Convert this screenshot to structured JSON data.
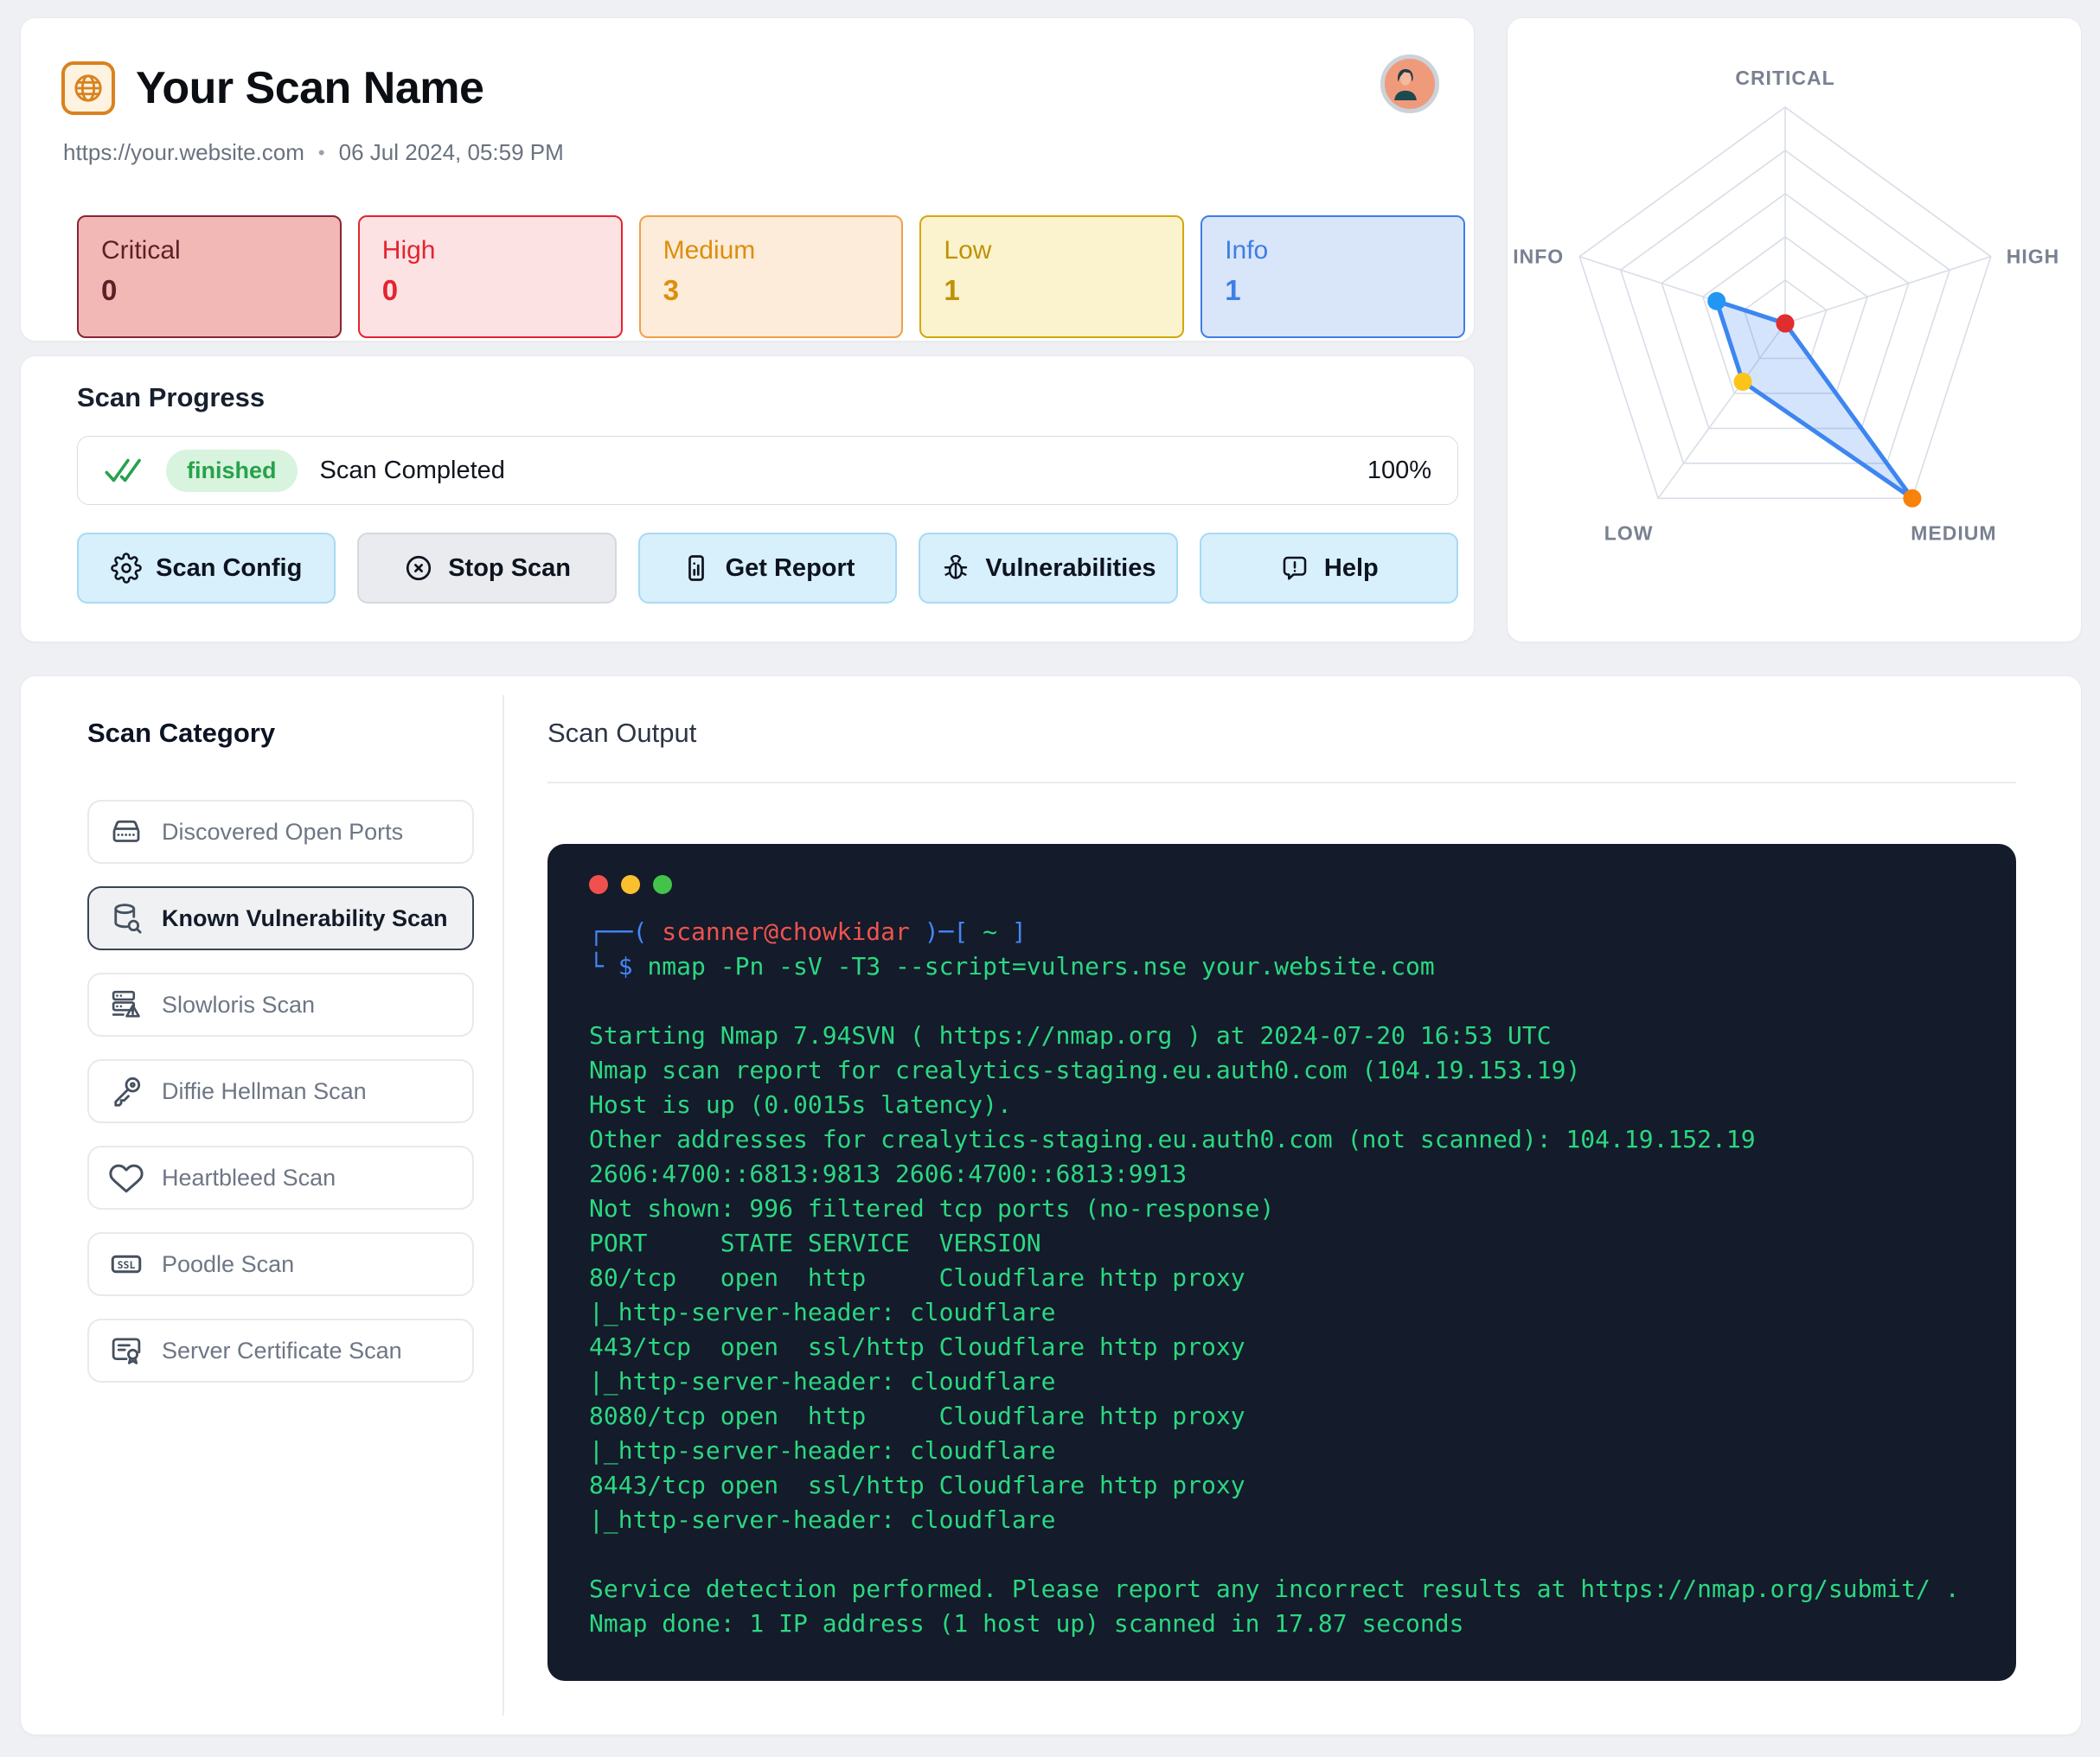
{
  "header": {
    "title": "Your Scan Name",
    "url": "https://your.website.com",
    "separator": "•",
    "timestamp": "06 Jul 2024, 05:59 PM",
    "severities": [
      {
        "label": "Critical",
        "count": "0",
        "bg": "#f2b8b5",
        "border": "#8a2433",
        "text": "#5e1f26"
      },
      {
        "label": "High",
        "count": "0",
        "bg": "#fde2e4",
        "border": "#e3242e",
        "text": "#e3242e"
      },
      {
        "label": "Medium",
        "count": "3",
        "bg": "#fcecd9",
        "border": "#f0a04a",
        "text": "#dd8e0b"
      },
      {
        "label": "Low",
        "count": "1",
        "bg": "#fbf3cd",
        "border": "#d2a80b",
        "text": "#bd920a"
      },
      {
        "label": "Info",
        "count": "1",
        "bg": "#d9e6f9",
        "border": "#3e7ee6",
        "text": "#3e7ee6"
      }
    ]
  },
  "progress": {
    "heading": "Scan Progress",
    "status_badge": "finished",
    "status_text": "Scan Completed",
    "percent": "100%",
    "badge_bg": "#d8f3de",
    "badge_text_color": "#27a24b",
    "buttons": [
      {
        "label": "Scan Config",
        "icon": "gear-icon",
        "variant": "blue"
      },
      {
        "label": "Stop Scan",
        "icon": "stop-icon",
        "variant": "gray"
      },
      {
        "label": "Get Report",
        "icon": "report-icon",
        "variant": "blue"
      },
      {
        "label": "Vulnerabilities",
        "icon": "bug-icon",
        "variant": "blue"
      },
      {
        "label": "Help",
        "icon": "help-icon",
        "variant": "blue"
      }
    ]
  },
  "chart_data": {
    "type": "radar",
    "title": "",
    "categories": [
      "CRITICAL",
      "HIGH",
      "MEDIUM",
      "LOW",
      "INFO"
    ],
    "values": [
      0,
      0,
      3,
      1,
      1
    ],
    "max": 3,
    "rings": 5,
    "fill": "rgba(66,133,244,0.22)",
    "stroke": "#3d86f0",
    "grid_color": "#d8dde7",
    "label_color": "#798191",
    "point_colors": [
      "#e12d2d",
      "#e12d2d",
      "#f9820a",
      "#fcc419",
      "#2196f3"
    ]
  },
  "categories_panel": {
    "heading": "Scan Category",
    "items": [
      {
        "label": "Discovered Open Ports",
        "icon": "ports-icon",
        "selected": false
      },
      {
        "label": "Known Vulnerability Scan",
        "icon": "database-search-icon",
        "selected": true
      },
      {
        "label": "Slowloris Scan",
        "icon": "server-warning-icon",
        "selected": false
      },
      {
        "label": "Diffie Hellman Scan",
        "icon": "key-icon",
        "selected": false
      },
      {
        "label": "Heartbleed Scan",
        "icon": "heart-icon",
        "selected": false
      },
      {
        "label": "Poodle Scan",
        "icon": "ssl-icon",
        "selected": false
      },
      {
        "label": "Server Certificate Scan",
        "icon": "certificate-icon",
        "selected": false
      }
    ]
  },
  "output_panel": {
    "heading": "Scan Output",
    "terminal": {
      "bg": "#141b2a",
      "dot_colors": [
        "#f1504e",
        "#fbc02d",
        "#43c34a"
      ],
      "text_colors": {
        "blue": "#4387f6",
        "red": "#f0534f",
        "green": "#2bd881"
      },
      "prompt_line1": [
        {
          "text": "┌──( ",
          "color": "blue"
        },
        {
          "text": "scanner@chowkidar",
          "color": "red"
        },
        {
          "text": " )─[ ",
          "color": "blue"
        },
        {
          "text": "~",
          "color": "green"
        },
        {
          "text": " ]",
          "color": "blue"
        }
      ],
      "prompt_line2": [
        {
          "text": "└ ",
          "color": "blue"
        },
        {
          "text": "$ ",
          "color": "blue"
        },
        {
          "text": "nmap -Pn -sV -T3 --script=vulners.nse your.website.com",
          "color": "green"
        }
      ],
      "lines": [
        "",
        "Starting Nmap 7.94SVN ( https://nmap.org ) at 2024-07-20 16:53 UTC",
        "Nmap scan report for crealytics-staging.eu.auth0.com (104.19.153.19)",
        "Host is up (0.0015s latency).",
        "Other addresses for crealytics-staging.eu.auth0.com (not scanned): 104.19.152.19",
        "2606:4700::6813:9813 2606:4700::6813:9913",
        "Not shown: 996 filtered tcp ports (no-response)",
        "PORT     STATE SERVICE  VERSION",
        "80/tcp   open  http     Cloudflare http proxy",
        "|_http-server-header: cloudflare",
        "443/tcp  open  ssl/http Cloudflare http proxy",
        "|_http-server-header: cloudflare",
        "8080/tcp open  http     Cloudflare http proxy",
        "|_http-server-header: cloudflare",
        "8443/tcp open  ssl/http Cloudflare http proxy",
        "|_http-server-header: cloudflare",
        "",
        "Service detection performed. Please report any incorrect results at https://nmap.org/submit/ .",
        "Nmap done: 1 IP address (1 host up) scanned in 17.87 seconds"
      ]
    }
  }
}
